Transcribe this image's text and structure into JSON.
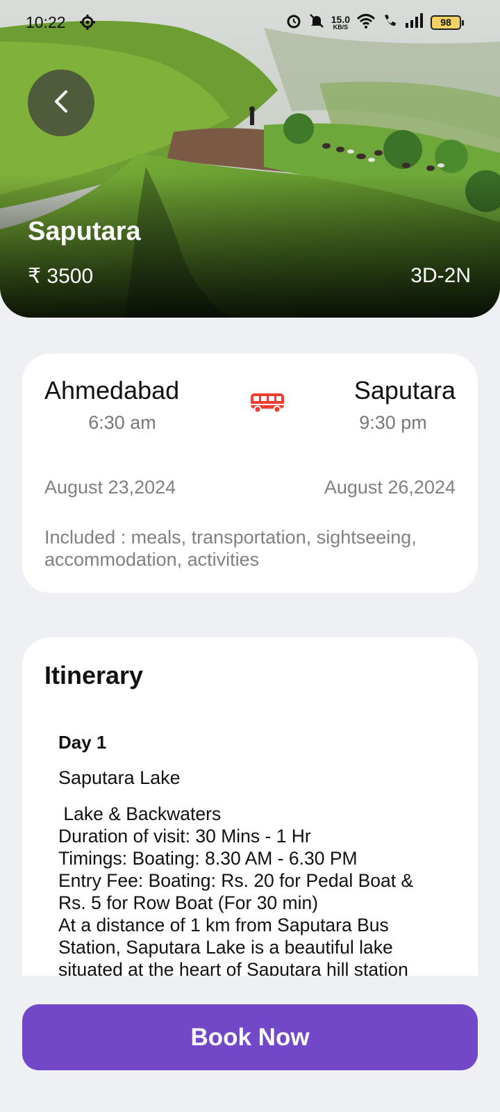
{
  "status_bar": {
    "time": "10:22",
    "net_speed": "15.0",
    "net_unit": "KB/S",
    "battery": "98",
    "icons": [
      "gear-icon",
      "alarm-icon",
      "mute-bell-icon",
      "wifi-icon",
      "wifi-call-icon",
      "signal-icon",
      "battery-icon"
    ]
  },
  "hero": {
    "title": "Saputara",
    "price": "₹ 3500",
    "duration": "3D-2N"
  },
  "trip": {
    "from_city": "Ahmedabad",
    "from_time": "6:30 am",
    "to_city": "Saputara",
    "to_time": "9:30 pm",
    "from_date": "August 23,2024",
    "to_date": "August 26,2024",
    "included": "Included : meals, transportation, sightseeing, accommodation, activities",
    "bus_icon_color": "#f03d2f"
  },
  "itinerary": {
    "title": "Itinerary",
    "day_label": "Day 1",
    "place": "Saputara Lake",
    "lines": [
      " Lake & Backwaters",
      "Duration of visit: 30 Mins - 1 Hr",
      "Timings: Boating: 8.30 AM - 6.30 PM",
      "Entry Fee: Boating: Rs. 20 for Pedal Boat &",
      "Rs. 5 for Row Boat (For 30 min)",
      "At a distance of 1 km from Saputara Bus",
      "Station, Saputara Lake is a beautiful lake",
      "situated at the heart of Saputara hill station"
    ]
  },
  "book_button": {
    "label": "Book Now",
    "color": "#7248c8"
  }
}
